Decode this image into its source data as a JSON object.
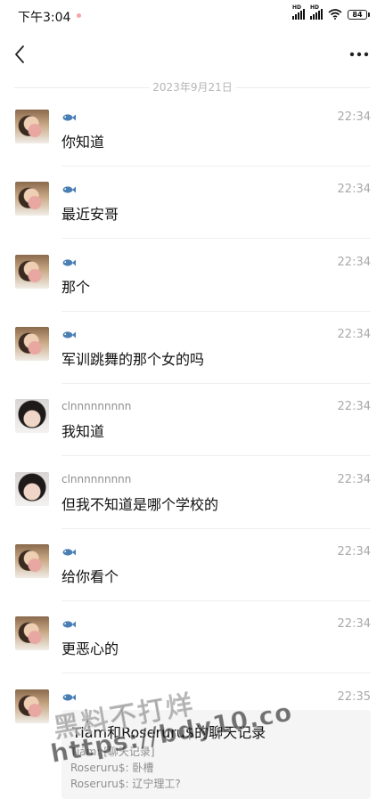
{
  "status_bar": {
    "time": "下午3:04",
    "signal_labels": [
      "HD",
      "HD"
    ],
    "battery": "84"
  },
  "nav": {
    "back_icon": "chevron-left-icon",
    "more_icon": "more-dots-icon"
  },
  "date_divider": "2023年9月21日",
  "messages": [
    {
      "avatar": "avatar-girl-room",
      "sender": "",
      "sender_icon": "fish-icon",
      "time": "22:34",
      "text": "你知道"
    },
    {
      "avatar": "avatar-girl-room",
      "sender": "",
      "sender_icon": "fish-icon",
      "time": "22:34",
      "text": "最近安哥"
    },
    {
      "avatar": "avatar-girl-room",
      "sender": "",
      "sender_icon": "fish-icon",
      "time": "22:34",
      "text": "那个"
    },
    {
      "avatar": "avatar-girl-room",
      "sender": "",
      "sender_icon": "fish-icon",
      "time": "22:34",
      "text": "军训跳舞的那个女的吗"
    },
    {
      "avatar": "avatar-girl-face",
      "sender": "clnnnnnnnnn",
      "sender_icon": "",
      "time": "22:34",
      "text": "我知道"
    },
    {
      "avatar": "avatar-girl-face",
      "sender": "clnnnnnnnnn",
      "sender_icon": "",
      "time": "22:34",
      "text": "但我不知道是哪个学校的"
    },
    {
      "avatar": "avatar-girl-room",
      "sender": "",
      "sender_icon": "fish-icon",
      "time": "22:34",
      "text": "给你看个"
    },
    {
      "avatar": "avatar-girl-room",
      "sender": "",
      "sender_icon": "fish-icon",
      "time": "22:34",
      "text": "更恶心的"
    },
    {
      "avatar": "avatar-girl-room",
      "sender": "",
      "sender_icon": "fish-icon",
      "time": "22:35",
      "text": ""
    }
  ],
  "record_card": {
    "title": "Tiám和Roseruru$的聊天记录",
    "lines": [
      "Tiám: [聊天记录]",
      "Roseruru$: 卧槽",
      "Roseruru$: 辽宁理工?"
    ]
  },
  "watermark": {
    "line1": "黑料不打烊",
    "line2": "https://bdy10.co"
  },
  "colors": {
    "text_primary": "#111111",
    "text_secondary": "#8e8e8e",
    "time": "#a9a9a9",
    "divider": "#efefef",
    "card_bg": "#f5f5f5",
    "fish_icon": "#4a7fb5"
  }
}
